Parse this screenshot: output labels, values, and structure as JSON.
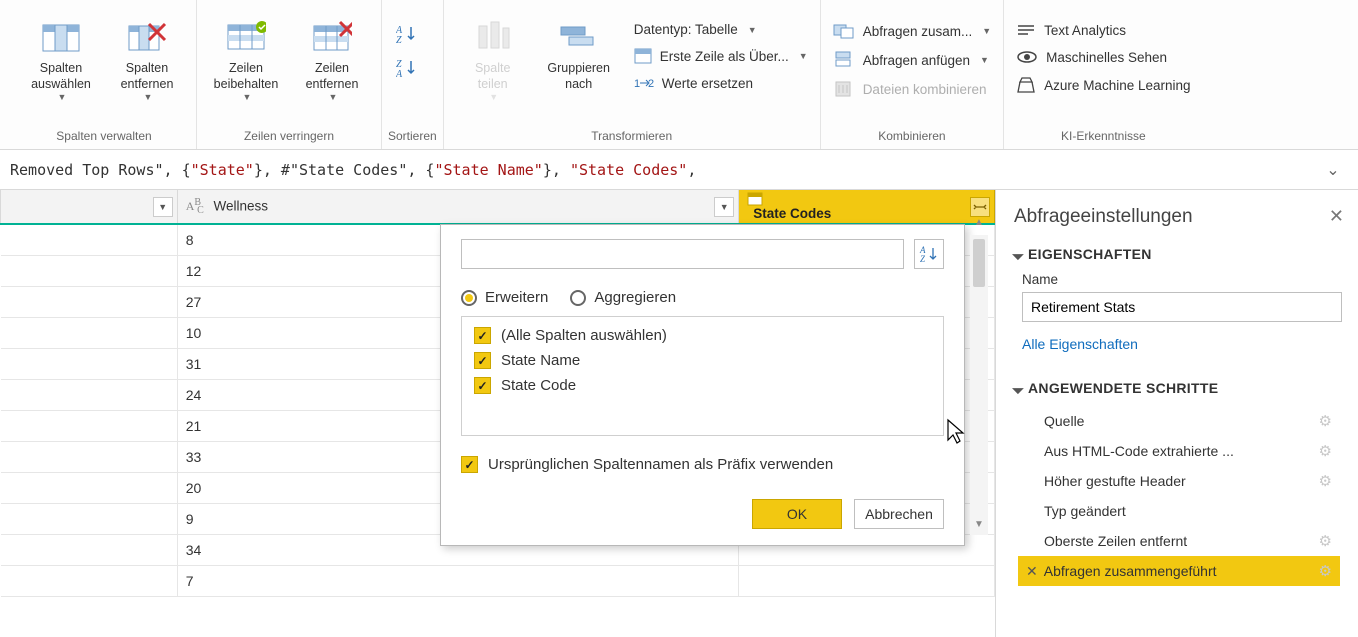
{
  "ribbon": {
    "groups": {
      "columns": {
        "label": "Spalten verwalten",
        "choose": "Spalten\nauswählen",
        "remove": "Spalten\nentfernen"
      },
      "rows": {
        "label": "Zeilen verringern",
        "keep": "Zeilen\nbeibehalten",
        "remove": "Zeilen\nentfernen"
      },
      "sort": {
        "label": "Sortieren"
      },
      "transform": {
        "label": "Transformieren",
        "split": "Spalte\nteilen",
        "group": "Gruppieren\nnach",
        "datatype": "Datentyp: Tabelle",
        "first_row": "Erste Zeile als Über...",
        "replace": "Werte ersetzen"
      },
      "combine": {
        "label": "Kombinieren",
        "merge": "Abfragen zusam...",
        "append": "Abfragen anfügen",
        "combine_files": "Dateien kombinieren"
      },
      "ki": {
        "label": "KI-Erkenntnisse",
        "text": "Text Analytics",
        "vision": "Maschinelles Sehen",
        "aml": "Azure Machine Learning"
      }
    }
  },
  "formula": {
    "pre": "Removed Top Rows\", {",
    "s1": "\"State\"",
    "mid1": "}, #\"State Codes\", {",
    "s2": "\"State Name\"",
    "mid2": "}, ",
    "s3": "\"State Codes\"",
    "tail": ","
  },
  "grid": {
    "col_wellness": "Wellness",
    "col_state_codes": "State Codes",
    "rows": [
      "8",
      "12",
      "27",
      "10",
      "31",
      "24",
      "21",
      "33",
      "20",
      "9",
      "34",
      "7"
    ]
  },
  "popup": {
    "search_placeholder": "",
    "radio_expand": "Erweitern",
    "radio_aggregate": "Aggregieren",
    "select_all": "(Alle Spalten auswählen)",
    "c1": "State Name",
    "c2": "State Code",
    "prefix": "Ursprünglichen Spaltennamen als Präfix verwenden",
    "ok": "OK",
    "cancel": "Abbrechen"
  },
  "settings": {
    "title": "Abfrageeinstellungen",
    "properties": "EIGENSCHAFTEN",
    "name_label": "Name",
    "name_value": "Retirement Stats",
    "all_props": "Alle Eigenschaften",
    "steps_title": "ANGEWENDETE SCHRITTE",
    "steps": [
      {
        "label": "Quelle",
        "gear": true
      },
      {
        "label": "Aus HTML-Code extrahierte ...",
        "gear": true
      },
      {
        "label": "Höher gestufte Header",
        "gear": true
      },
      {
        "label": "Typ geändert",
        "gear": false
      },
      {
        "label": "Oberste Zeilen entfernt",
        "gear": true
      },
      {
        "label": "Abfragen zusammengeführt",
        "gear": true,
        "active": true
      }
    ]
  }
}
